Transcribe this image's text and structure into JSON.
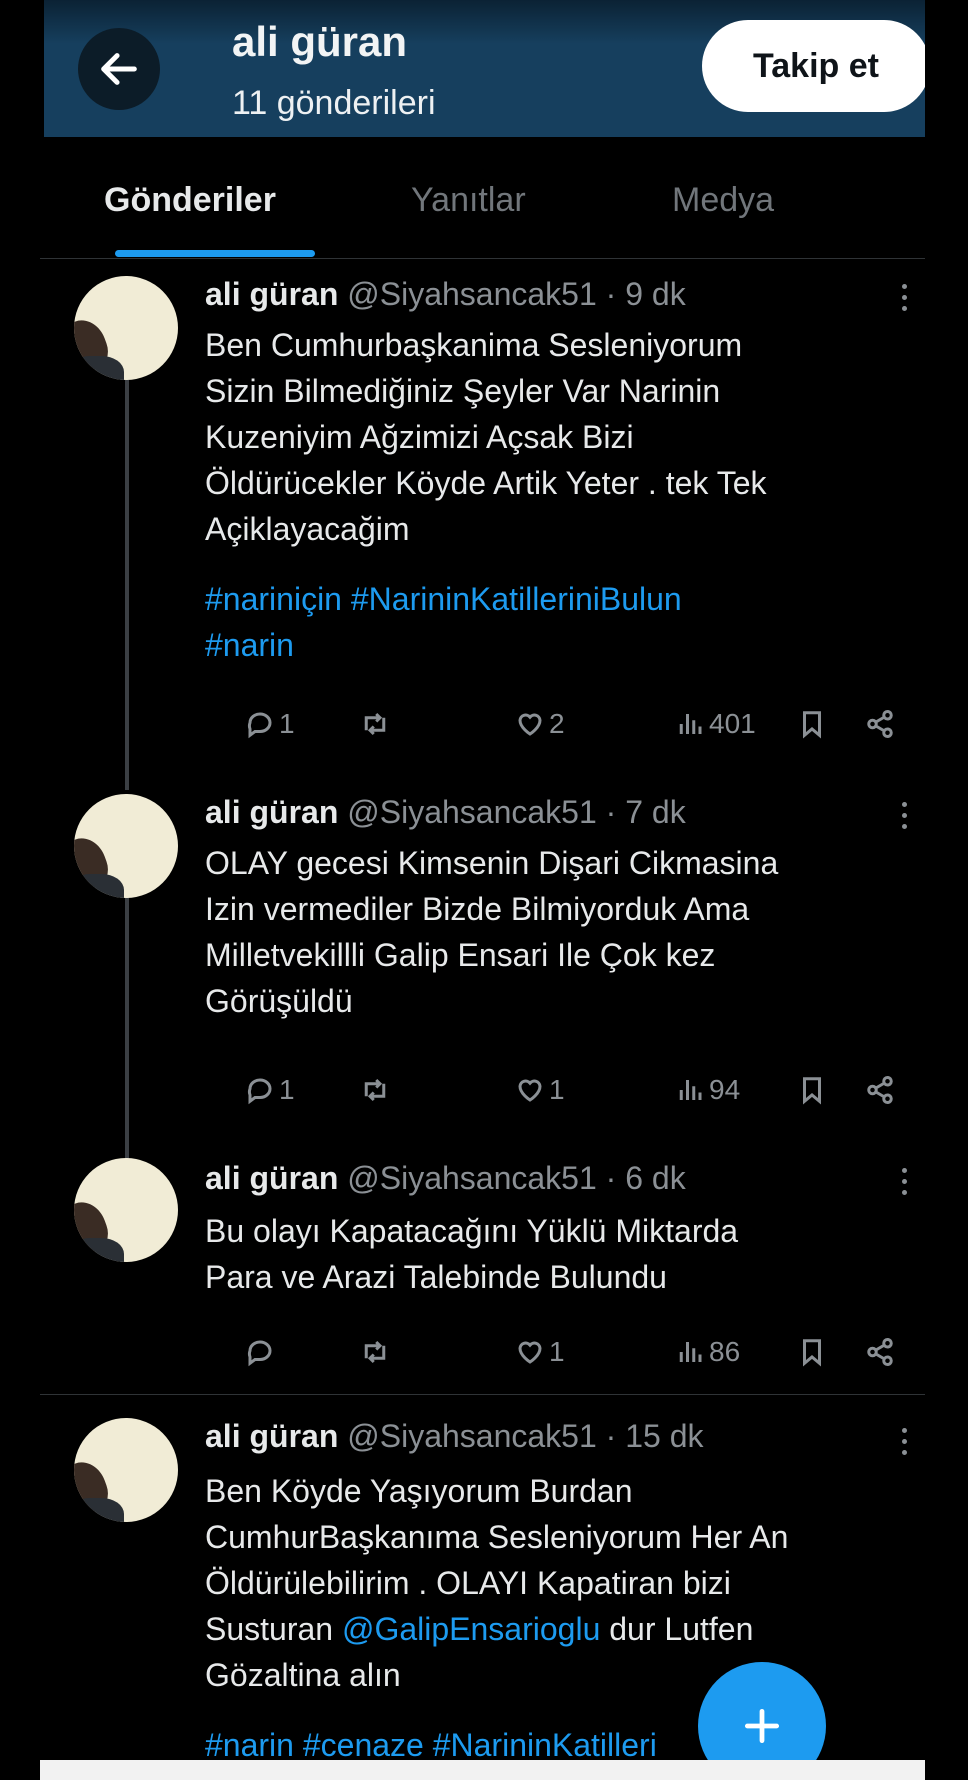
{
  "header": {
    "profile_name": "ali güran",
    "post_count": "11 gönderileri",
    "follow_label": "Takip et"
  },
  "tabs": [
    {
      "label": "Gönderiler",
      "active": true
    },
    {
      "label": "Yanıtlar",
      "active": false
    },
    {
      "label": "Medya",
      "active": false
    }
  ],
  "tweets": [
    {
      "name": "ali güran",
      "meta": "@Siyahsancak51 · 9 dk",
      "text": "Ben Cumhurbaşkanima Sesleniyorum\nSizin Bilmediğiniz Şeyler Var  Narinin\nKuzeniyim Ağzimizi Açsak Bizi\nÖldürücekler Köyde Artik Yeter . tek Tek\nAçiklayacağim",
      "hashtags": "#nariniçin #NarininKatilleriniBulun\n#narin",
      "replies": "1",
      "reposts": "",
      "likes": "2",
      "views": "401"
    },
    {
      "name": "ali güran",
      "meta": "@Siyahsancak51 · 7 dk",
      "text": "OLAY gecesi Kimsenin Dişari Cikmasina\nIzin vermediler Bizde Bilmiyorduk Ama\nMilletvekillli Galip Ensari Ile Çok kez\nGörüşüldü",
      "replies": "1",
      "reposts": "",
      "likes": "1",
      "views": "94"
    },
    {
      "name": "ali güran",
      "meta": "@Siyahsancak51 · 6 dk",
      "text": "Bu olayı Kapatacağını Yüklü Miktarda\nPara ve Arazi Talebinde Bulundu",
      "replies": "",
      "reposts": "",
      "likes": "1",
      "views": "86"
    },
    {
      "name": "ali güran",
      "meta": "@Siyahsancak51 · 15 dk",
      "text_before_mention": "Ben Köyde Yaşıyorum Burdan\nCumhurBaşkanıma  Sesleniyorum Her An\nÖldürülebilirim . OLAYI Kapatiran bizi\nSusturan ",
      "mention": "@GalipEnsarioglu",
      "text_after_mention": "  dur  Lutfen\nGözaltina alın",
      "hashtags": "#narin #cenaze #NarininKatilleri"
    }
  ],
  "icons": {
    "back": "arrow-left-icon",
    "more": "more-vertical-icon",
    "reply": "reply-icon",
    "repost": "repost-icon",
    "like": "heart-icon",
    "views": "views-icon",
    "bookmark": "bookmark-icon",
    "share": "share-icon",
    "compose": "plus-icon"
  },
  "colors": {
    "accent": "#1d9bf0",
    "header_bg": "#163f5e",
    "background": "#000000",
    "muted": "#8b9095"
  }
}
